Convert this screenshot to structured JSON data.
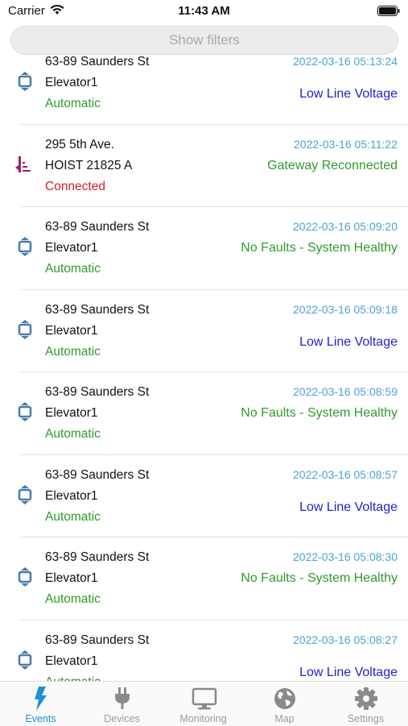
{
  "status_bar": {
    "carrier": "Carrier",
    "time": "11:43 AM"
  },
  "filters": {
    "label": "Show filters"
  },
  "colors": {
    "timestamp": "#4aa3d6",
    "status_green": "#2f9a2f",
    "status_red": "#d3202a",
    "event_blue": "#2222cc",
    "event_green": "#2f9a2f",
    "elevator_icon": "#4a7ba8",
    "hoist_icon": "#a0206a",
    "tab_active": "#1e90d9",
    "tab_inactive": "#9a9a9a"
  },
  "events": [
    {
      "icon": "elevator-icon",
      "address": "63-89 Saunders St",
      "device": "Elevator1",
      "status": "Automatic",
      "status_color": "#2f9a2f",
      "timestamp": "2022-03-16 05:13:24",
      "event": "Low Line Voltage",
      "event_color": "#2222cc"
    },
    {
      "icon": "hoist-icon",
      "address": "295 5th Ave.",
      "device": "HOIST 21825 A",
      "status": "Connected",
      "status_color": "#d3202a",
      "timestamp": "2022-03-16 05:11:22",
      "event": "Gateway Reconnected",
      "event_color": "#2f9a2f"
    },
    {
      "icon": "elevator-icon",
      "address": "63-89 Saunders St",
      "device": "Elevator1",
      "status": "Automatic",
      "status_color": "#2f9a2f",
      "timestamp": "2022-03-16 05:09:20",
      "event": "No Faults - System Healthy",
      "event_color": "#2f9a2f"
    },
    {
      "icon": "elevator-icon",
      "address": "63-89 Saunders St",
      "device": "Elevator1",
      "status": "Automatic",
      "status_color": "#2f9a2f",
      "timestamp": "2022-03-16 05:09:18",
      "event": "Low Line Voltage",
      "event_color": "#2222cc"
    },
    {
      "icon": "elevator-icon",
      "address": "63-89 Saunders St",
      "device": "Elevator1",
      "status": "Automatic",
      "status_color": "#2f9a2f",
      "timestamp": "2022-03-16 05:08:59",
      "event": "No Faults - System Healthy",
      "event_color": "#2f9a2f"
    },
    {
      "icon": "elevator-icon",
      "address": "63-89 Saunders St",
      "device": "Elevator1",
      "status": "Automatic",
      "status_color": "#2f9a2f",
      "timestamp": "2022-03-16 05:08:57",
      "event": "Low Line Voltage",
      "event_color": "#2222cc"
    },
    {
      "icon": "elevator-icon",
      "address": "63-89 Saunders St",
      "device": "Elevator1",
      "status": "Automatic",
      "status_color": "#2f9a2f",
      "timestamp": "2022-03-16 05:08:30",
      "event": "No Faults - System Healthy",
      "event_color": "#2f9a2f"
    },
    {
      "icon": "elevator-icon",
      "address": "63-89 Saunders St",
      "device": "Elevator1",
      "status": "Automatic",
      "status_color": "#2f9a2f",
      "timestamp": "2022-03-16 05:08:27",
      "event": "Low Line Voltage",
      "event_color": "#2222cc"
    }
  ],
  "tabs": [
    {
      "label": "Events",
      "icon": "bolt-icon",
      "active": true
    },
    {
      "label": "Devices",
      "icon": "plug-icon",
      "active": false
    },
    {
      "label": "Monitoring",
      "icon": "monitor-icon",
      "active": false
    },
    {
      "label": "Map",
      "icon": "globe-icon",
      "active": false
    },
    {
      "label": "Settings",
      "icon": "gear-icon",
      "active": false
    }
  ]
}
